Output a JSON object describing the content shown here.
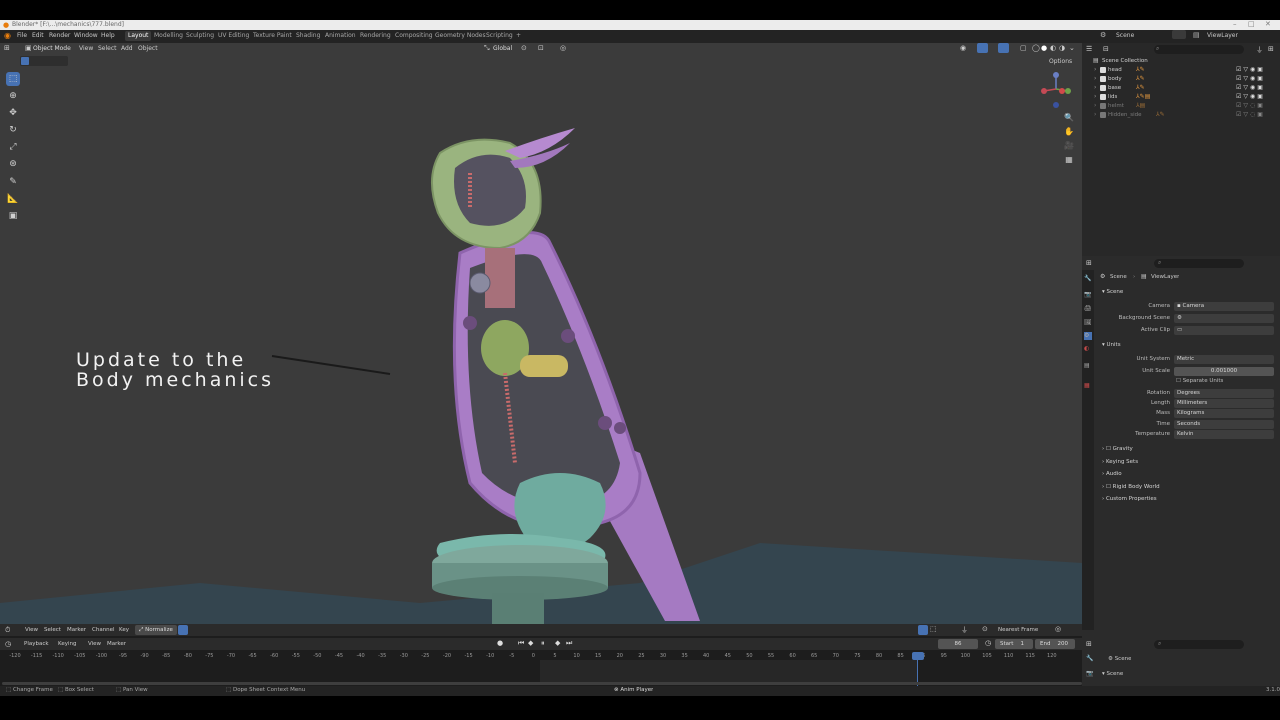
{
  "window": {
    "title": "Blender* [F:\\...\\mechanics\\777.blend]",
    "controls": [
      "–",
      "□",
      "✕"
    ]
  },
  "menu": [
    "File",
    "Edit",
    "Render",
    "Window",
    "Help"
  ],
  "workspaces": [
    {
      "label": "Layout",
      "active": true
    },
    {
      "label": "Modelling"
    },
    {
      "label": "Sculpting"
    },
    {
      "label": "UV Editing"
    },
    {
      "label": "Texture Paint"
    },
    {
      "label": "Shading"
    },
    {
      "label": "Animation"
    },
    {
      "label": "Rendering"
    },
    {
      "label": "Compositing"
    },
    {
      "label": "Geometry Nodes"
    },
    {
      "label": "Scripting"
    },
    {
      "label": "+"
    }
  ],
  "topright": {
    "scene": "Scene",
    "view_layer": "ViewLayer"
  },
  "viewport": {
    "mode": "Object Mode",
    "header_menu": [
      "View",
      "Select",
      "Add",
      "Object"
    ],
    "transform_orientation": "Global",
    "options": "Options",
    "overlay_text_line1": "Update to the",
    "overlay_text_line2": "Body mechanics",
    "tools": [
      "select-box",
      "cursor",
      "move",
      "rotate",
      "scale",
      "transform",
      "annotate",
      "measure",
      "add-cube"
    ],
    "colors": {
      "background": "#3b3b3b",
      "purple": "#a77bc4",
      "green": "#8fae74",
      "teal": "#6aa99c",
      "floor": "#3a4a55"
    }
  },
  "outliner": {
    "root": "Scene Collection",
    "items": [
      {
        "name": "head",
        "dim": false
      },
      {
        "name": "body",
        "dim": false
      },
      {
        "name": "base",
        "dim": false
      },
      {
        "name": "lids",
        "dim": false
      },
      {
        "name": "helmt",
        "dim": true
      },
      {
        "name": "Hidden_side",
        "dim": true
      }
    ]
  },
  "properties": {
    "breadcrumb": [
      "Scene",
      "ViewLayer"
    ],
    "scene_panel": "Scene",
    "camera_label": "Camera",
    "camera_value": "Camera",
    "background_scene_label": "Background Scene",
    "active_clip_label": "Active Clip",
    "units_panel": "Units",
    "unit_system_label": "Unit System",
    "unit_system_value": "Metric",
    "unit_scale_label": "Unit Scale",
    "unit_scale_value": "0.001000",
    "separate_units": "Separate Units",
    "rotation_label": "Rotation",
    "rotation_value": "Degrees",
    "length_label": "Length",
    "length_value": "Millimeters",
    "mass_label": "Mass",
    "mass_value": "Kilograms",
    "time_label": "Time",
    "time_value": "Seconds",
    "temperature_label": "Temperature",
    "temperature_value": "Kelvin",
    "collapsed_panels": [
      "Gravity",
      "Keying Sets",
      "Audio",
      "Rigid Body World",
      "Custom Properties"
    ]
  },
  "timeline": {
    "header_menu": [
      "View",
      "Select",
      "Marker",
      "Channel",
      "Key"
    ],
    "normalize": "Normalize",
    "playback_menu": [
      "Playback",
      "Keying",
      "View",
      "Marker"
    ],
    "interpolation": "Nearest Frame",
    "current_frame": "86",
    "start_label": "Start",
    "start": "1",
    "end_label": "End",
    "end": "200",
    "ticks": [
      "-120",
      "-115",
      "-110",
      "-105",
      "-100",
      "-95",
      "-90",
      "-85",
      "-80",
      "-75",
      "-70",
      "-65",
      "-60",
      "-55",
      "-50",
      "-45",
      "-40",
      "-35",
      "-30",
      "-25",
      "-20",
      "-15",
      "-10",
      "-5",
      "0",
      "5",
      "10",
      "15",
      "20",
      "25",
      "30",
      "35",
      "40",
      "45",
      "50",
      "55",
      "60",
      "65",
      "70",
      "75",
      "80",
      "85",
      "86",
      "95",
      "100",
      "105",
      "110",
      "115",
      "120"
    ]
  },
  "right_bottom": {
    "scene": "Scene",
    "scene2": "Scene"
  },
  "status": {
    "change_frame": "Change Frame",
    "box_select": "Box Select",
    "pan_view": "Pan View",
    "dope_sheet": "Dope Sheet Context Menu",
    "anim_player": "Anim Player",
    "version": "3.1.0"
  }
}
